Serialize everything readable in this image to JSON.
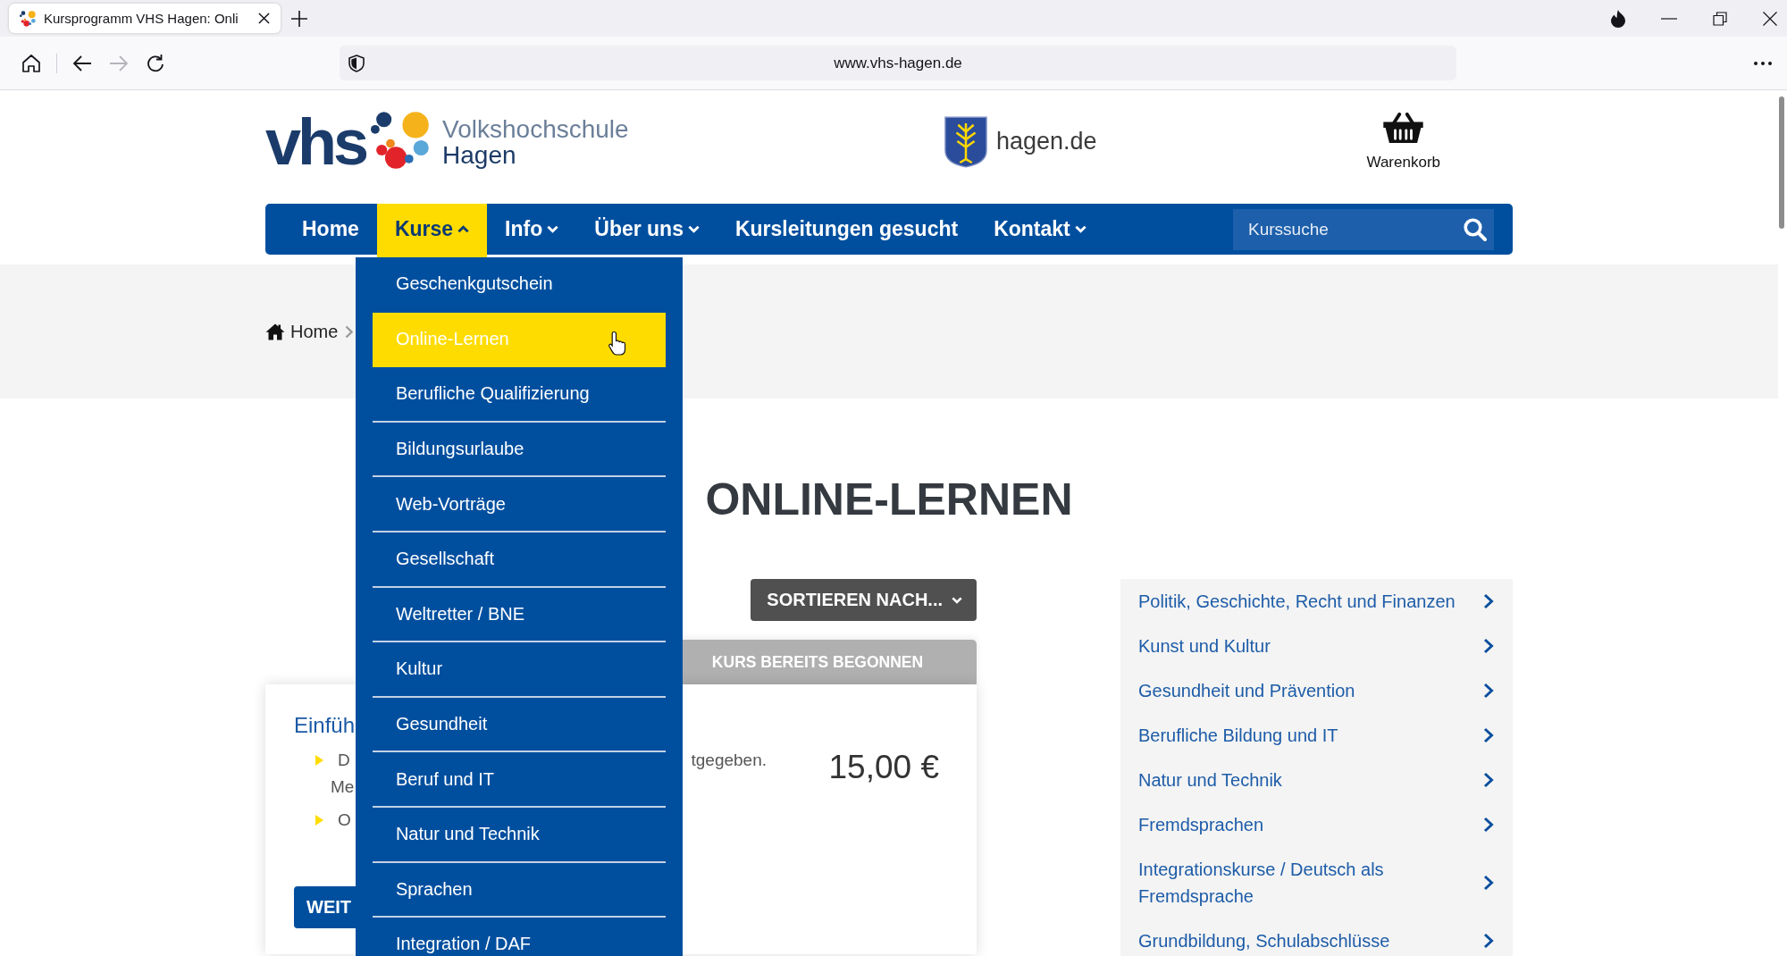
{
  "browser": {
    "tab": {
      "title": "Kursprogramm VHS Hagen: Onli"
    },
    "toolbar_buttons": [
      {
        "kind": "home",
        "disabled": false
      },
      {
        "kind": "back",
        "disabled": false
      },
      {
        "kind": "forward",
        "disabled": true
      },
      {
        "kind": "reload",
        "disabled": false
      }
    ],
    "address": "www.vhs-hagen.de"
  },
  "header": {
    "logo": {
      "mark": "vhs",
      "line_1": "Volkshochschule",
      "line_2": "Hagen"
    },
    "city_link": "hagen.de",
    "cart": "Warenkorb"
  },
  "nav": {
    "items": [
      {
        "label": "Home",
        "kind": "link",
        "selected": false
      },
      {
        "label": "Kurse",
        "kind": "menu",
        "selected": true,
        "expanded": true,
        "submenu": [
          {
            "label": "Geschenkgutschein",
            "selected": false
          },
          {
            "label": "Online-Lernen",
            "selected": true
          },
          {
            "label": "Berufliche Qualifizierung",
            "selected": false
          },
          {
            "label": "Bildungsurlaube",
            "selected": false
          },
          {
            "label": "Web-Vorträge",
            "selected": false
          },
          {
            "label": "Gesellschaft",
            "selected": false
          },
          {
            "label": "Weltretter / BNE",
            "selected": false
          },
          {
            "label": "Kultur",
            "selected": false
          },
          {
            "label": "Gesundheit",
            "selected": false
          },
          {
            "label": "Beruf und IT",
            "selected": false
          },
          {
            "label": "Natur und Technik",
            "selected": false
          },
          {
            "label": "Sprachen",
            "selected": false
          },
          {
            "label": "Integration / DAF",
            "selected": false
          }
        ]
      },
      {
        "label": "Info",
        "kind": "menu",
        "selected": false,
        "expanded": false
      },
      {
        "label": "Über uns",
        "kind": "menu",
        "selected": false,
        "expanded": false
      },
      {
        "label": "Kursleitungen gesucht",
        "kind": "link",
        "selected": false
      },
      {
        "label": "Kontakt",
        "kind": "menu",
        "selected": false,
        "expanded": false
      }
    ],
    "search": {
      "placeholder": "Kurssuche"
    }
  },
  "breadcrumb": [
    {
      "label": "Home"
    }
  ],
  "page_title": "ONLINE-LERNEN",
  "sort_button": "SORTIEREN NACH...",
  "course_card": {
    "status": "KURS BEREITS BEGONNEN",
    "title": "Einfüh",
    "bullets": [
      {
        "start": "D",
        "end": "tgegeben.",
        "line_2": "Me"
      },
      {
        "start": "O"
      }
    ],
    "price": "15,00 €",
    "button": "WEIT"
  },
  "categories": [
    {
      "label": "Politik, Geschichte, Recht und Finanzen"
    },
    {
      "label": "Kunst und Kultur"
    },
    {
      "label": "Gesundheit und Prävention"
    },
    {
      "label": "Berufliche Bildung und IT"
    },
    {
      "label": "Natur und Technik"
    },
    {
      "label": "Fremdsprachen"
    },
    {
      "label": "Integrationskurse / Deutsch als Fremdsprache"
    },
    {
      "label": "Grundbildung, Schulabschlüsse"
    }
  ]
}
